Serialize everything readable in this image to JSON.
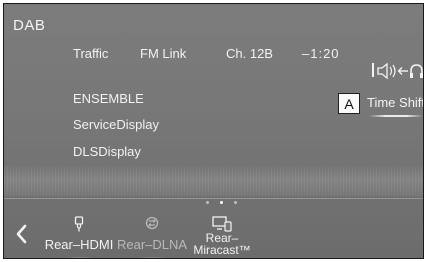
{
  "header": {
    "source": "DAB"
  },
  "info": {
    "traffic": "Traffic",
    "fm_link": "FM Link",
    "channel": "Ch. 12B",
    "time_offset": "–1:20"
  },
  "lines": {
    "ensemble": "ENSEMBLE",
    "service_display": "ServiceDisplay",
    "dls_display": "DLSDisplay"
  },
  "time_shift": {
    "label": "Time Shift",
    "marker": "A"
  },
  "audio_switch": {
    "icon": "speaker-to-headphones-icon"
  },
  "pager": {
    "count": 3,
    "active_index": 1
  },
  "dock": {
    "back_icon": "chevron-left-icon",
    "items": [
      {
        "label": "Rear–HDMI",
        "icon": "usb-plug-icon",
        "enabled": true
      },
      {
        "label": "Rear–DLNA",
        "icon": "network-share-icon",
        "enabled": false
      },
      {
        "label_line1": "Rear–",
        "label_line2": "Miracast™",
        "icon": "screen-device-icon",
        "enabled": true
      }
    ]
  },
  "colors": {
    "background": "#777777",
    "text": "#f2f2f2",
    "disabled_text": "#b9b9b9"
  }
}
